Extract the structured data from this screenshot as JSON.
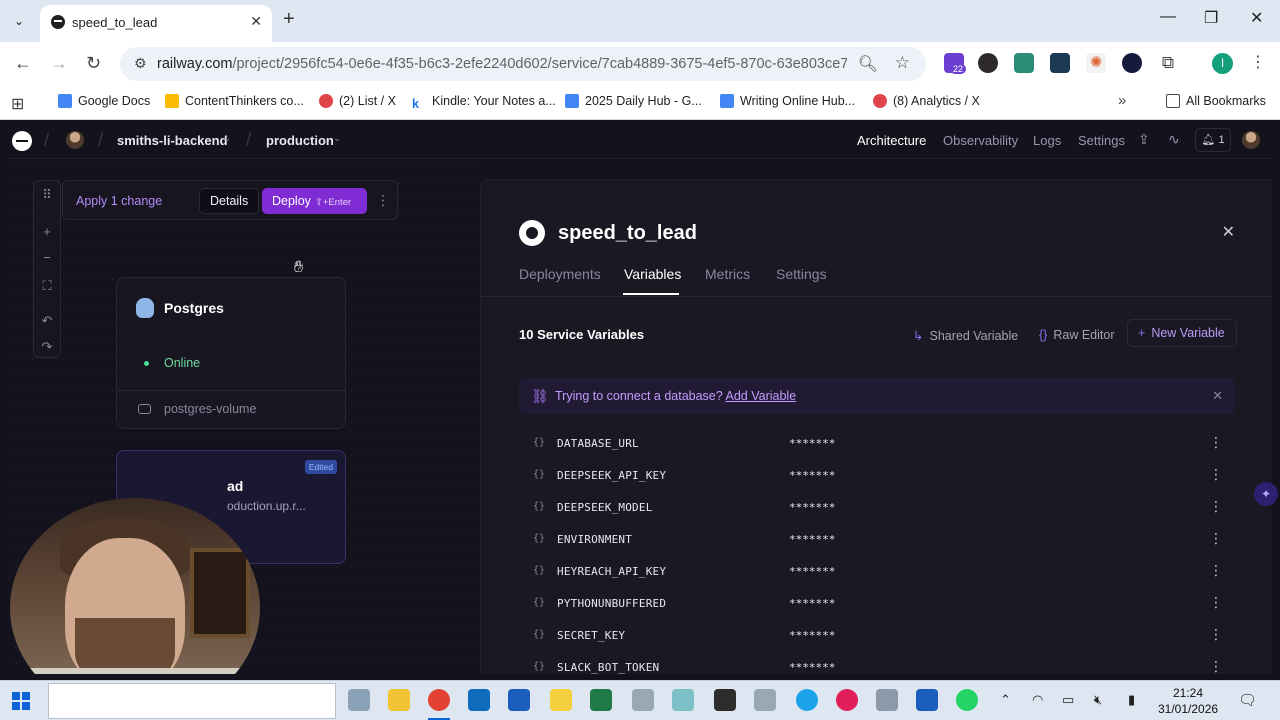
{
  "browser": {
    "tab_title": "speed_to_lead",
    "url_host": "railway.com",
    "url_path": "/project/2956fc54-0e6e-4f35-b6c3-2efe2240d602/service/7cab4889-3675-4ef5-870c-63e803ce70...",
    "extension_badge": "22",
    "profile_initial": "I",
    "bookmarks": [
      {
        "label": "Google Docs",
        "color": "#4285f4"
      },
      {
        "label": "ContentThinkers co...",
        "color": "#fbbc04"
      },
      {
        "label": "(2) List / X",
        "color": "#e0444b"
      },
      {
        "label": "Kindle: Your Notes a...",
        "color": "#1a73e8"
      },
      {
        "label": "2025 Daily Hub - G...",
        "color": "#4285f4"
      },
      {
        "label": "Writing Online Hub...",
        "color": "#4285f4"
      },
      {
        "label": "(8) Analytics / X",
        "color": "#e0444b"
      }
    ],
    "all_bookmarks": "All Bookmarks"
  },
  "app": {
    "project_name": "smiths-li-backend",
    "environment": "production",
    "nav": [
      "Architecture",
      "Observability",
      "Logs",
      "Settings"
    ],
    "notifications_count": "1",
    "applybar": {
      "apply_label": "Apply 1 change",
      "details": "Details",
      "deploy": "Deploy",
      "deploy_shortcut": "⇧+Enter"
    },
    "postgres": {
      "name": "Postgres",
      "status": "Online",
      "volume": "postgres-volume"
    },
    "service_card": {
      "badge": "Edited",
      "title_fragment": "ad",
      "url_fragment": "oduction.up.r..."
    },
    "panel": {
      "title": "speed_to_lead",
      "tabs": [
        "Deployments",
        "Variables",
        "Metrics",
        "Settings"
      ],
      "vars_count_label": "10 Service Variables",
      "shared_variable": "Shared Variable",
      "raw_editor": "Raw Editor",
      "new_variable": "New Variable",
      "banner_text": "Trying to connect a database?",
      "banner_link": "Add Variable",
      "variables": [
        {
          "name": "DATABASE_URL",
          "value": "*******"
        },
        {
          "name": "DEEPSEEK_API_KEY",
          "value": "*******"
        },
        {
          "name": "DEEPSEEK_MODEL",
          "value": "*******"
        },
        {
          "name": "ENVIRONMENT",
          "value": "*******"
        },
        {
          "name": "HEYREACH_API_KEY",
          "value": "*******"
        },
        {
          "name": "PYTHONUNBUFFERED",
          "value": "*******"
        },
        {
          "name": "SECRET_KEY",
          "value": "*******"
        },
        {
          "name": "SLACK_BOT_TOKEN",
          "value": "*******"
        }
      ]
    }
  },
  "taskbar": {
    "time": "21:24",
    "date": "31/01/2026"
  },
  "colors": {
    "accent": "#7f2cd4",
    "online": "#4ddc93"
  }
}
